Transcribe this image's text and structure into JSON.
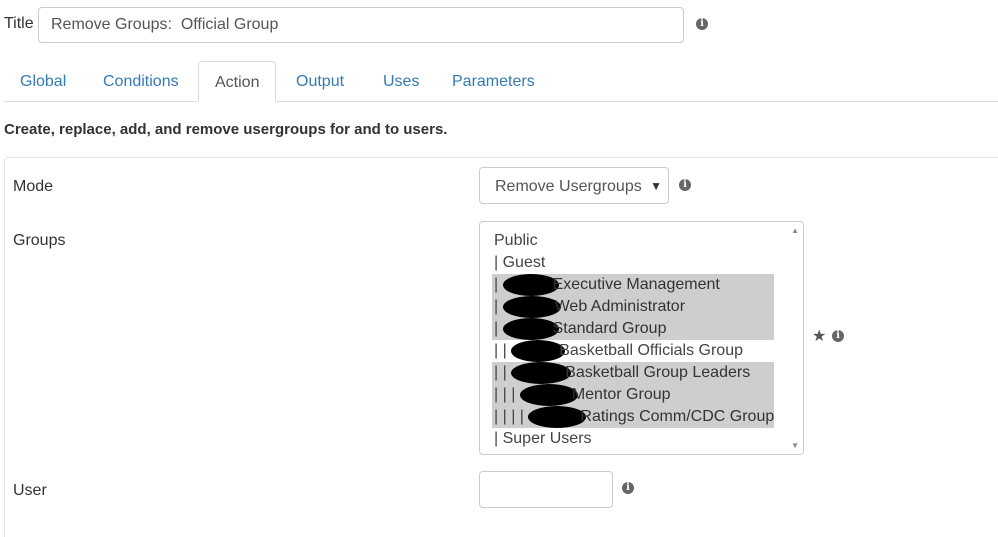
{
  "title_field": {
    "label": "Title",
    "value": "Remove Groups:  Official Group"
  },
  "tabs": [
    {
      "label": "Global",
      "active": false
    },
    {
      "label": "Conditions",
      "active": false
    },
    {
      "label": "Action",
      "active": true
    },
    {
      "label": "Output",
      "active": false
    },
    {
      "label": "Uses",
      "active": false
    },
    {
      "label": "Parameters",
      "active": false
    }
  ],
  "description": "Create, replace, add, and remove usergroups for and to users.",
  "mode": {
    "label": "Mode",
    "selected": "Remove Usergroups"
  },
  "groups": {
    "label": "Groups",
    "items": [
      {
        "prefix": "",
        "label": "Public",
        "selected": false
      },
      {
        "prefix": "| ",
        "label": "Guest",
        "selected": false
      },
      {
        "prefix": "| ",
        "label": "Executive Management",
        "selected": true
      },
      {
        "prefix": "| ",
        "label": "Web Administrator",
        "selected": true
      },
      {
        "prefix": "| ",
        "label": "Standard Group",
        "selected": true
      },
      {
        "prefix": "| | ",
        "label": "Basketball Officials Group",
        "selected": false
      },
      {
        "prefix": "| | ",
        "label": "Basketball Group Leaders",
        "selected": true
      },
      {
        "prefix": "| | | ",
        "label": "Mentor Group",
        "selected": true
      },
      {
        "prefix": "| | | | ",
        "label": "Ratings Comm/CDC Group",
        "selected": true
      },
      {
        "prefix": "| ",
        "label": "Super Users",
        "selected": false
      }
    ]
  },
  "user": {
    "label": "User",
    "value": ""
  },
  "icons": {
    "info": "info-icon",
    "star": "star-icon",
    "select_caret": "chevron-down-icon"
  },
  "colors": {
    "link": "#337ab7",
    "selected_bg": "#cecece",
    "border": "#cccccc"
  }
}
